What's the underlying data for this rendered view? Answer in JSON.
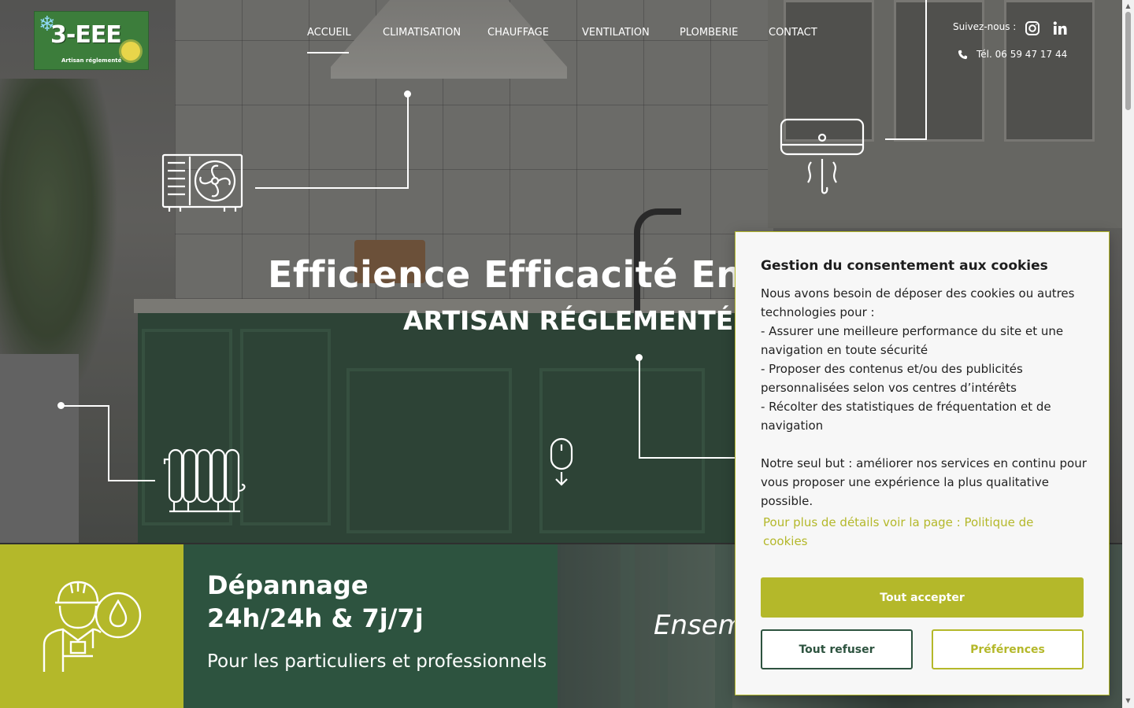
{
  "logo": {
    "text": "3-EEE",
    "subtitle": "Artisan réglementé"
  },
  "nav": {
    "items": [
      {
        "label": "ACCUEIL"
      },
      {
        "label": "CLIMATISATION"
      },
      {
        "label": "CHAUFFAGE"
      },
      {
        "label": "VENTILATION"
      },
      {
        "label": "PLOMBERIE"
      },
      {
        "label": "CONTACT"
      }
    ],
    "active": "ACCUEIL"
  },
  "social": {
    "label": "Suivez-nous :",
    "icons": [
      "instagram-icon",
      "linkedin-icon"
    ]
  },
  "phone": {
    "text": "Tél. 06 59 47 17 44",
    "icon": "phone-icon"
  },
  "hero": {
    "title": "Efficience Efficacité Ener",
    "subtitle": "ARTISAN RÉGLEMENTÉ",
    "icons": [
      "heat-pump-icon",
      "air-conditioner-icon",
      "radiator-icon",
      "mouse-scroll-icon"
    ]
  },
  "band": {
    "title_line1": "Dépannage",
    "title_line2": "24h/24h & 7j/7j",
    "subtitle": "Pour les particuliers et professionnels",
    "right_text": "Ensem",
    "icon": "plumber-icon"
  },
  "cookie": {
    "title": "Gestion du consentement aux cookies",
    "body": "Nous avons besoin de déposer des cookies ou autres technologies pour :\n- Assurer une meilleure performance du site et une navigation en toute sécurité\n- Proposer des contenus et/ou des publicités personnalisées selon vos centres d’intérêts\n- Récolter des statistiques de fréquentation et de navigation\n\nNotre seul but : améliorer nos services en continu pour vous proposer une expérience la plus qualitative possible.",
    "link": "Pour plus de détails voir la page : Politique de cookies",
    "accept_label": "Tout accepter",
    "refuse_label": "Tout refuser",
    "prefs_label": "Préférences"
  },
  "colors": {
    "accent": "#b4b82a",
    "dark_green": "#2d533f",
    "white": "#ffffff"
  }
}
